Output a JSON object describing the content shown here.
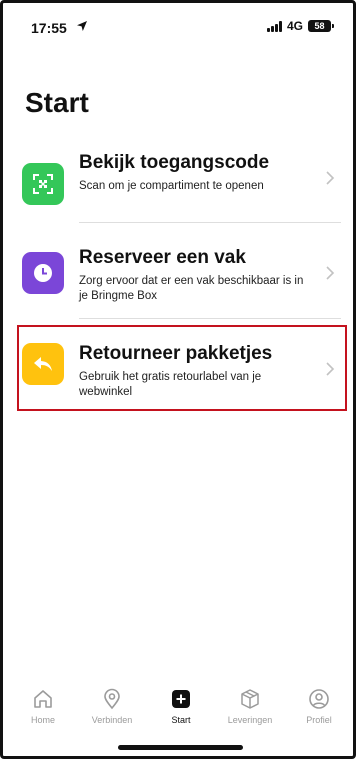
{
  "status": {
    "time": "17:55",
    "network": "4G",
    "battery": "58"
  },
  "page": {
    "title": "Start"
  },
  "items": [
    {
      "title": "Bekijk toegangscode",
      "subtitle": "Scan om je compartiment te openen",
      "color": "#34c759"
    },
    {
      "title": "Reserveer een vak",
      "subtitle": "Zorg ervoor dat er een vak beschikbaar is in je Bringme Box",
      "color": "#7b46d8"
    },
    {
      "title": "Retourneer pakketjes",
      "subtitle": "Gebruik het gratis retourlabel van je webwinkel",
      "color": "#ffc20e"
    }
  ],
  "tabs": [
    {
      "label": "Home",
      "icon": "home-icon"
    },
    {
      "label": "Verbinden",
      "icon": "location-pin-icon"
    },
    {
      "label": "Start",
      "icon": "plus-square-icon",
      "active": true
    },
    {
      "label": "Leveringen",
      "icon": "box-icon"
    },
    {
      "label": "Profiel",
      "icon": "profile-icon"
    }
  ],
  "colors": {
    "highlight": "#c4121e",
    "text": "#111111",
    "tab_inactive": "#9b9b9b"
  }
}
